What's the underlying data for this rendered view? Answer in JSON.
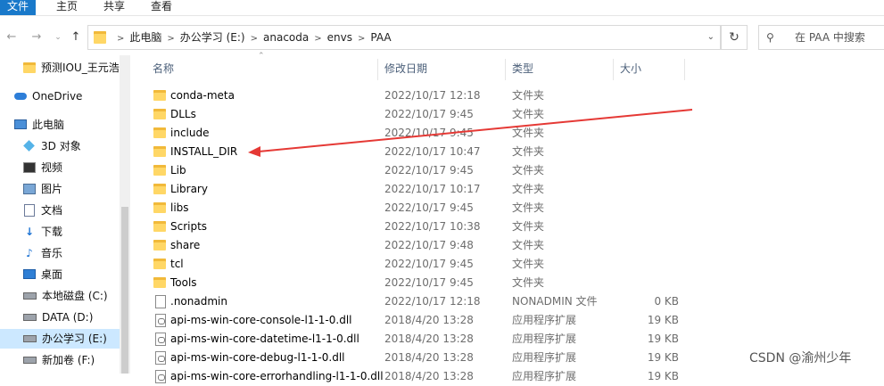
{
  "ribbon": {
    "tabs": [
      {
        "label": "文件",
        "active": true
      },
      {
        "label": "主页",
        "active": false
      },
      {
        "label": "共享",
        "active": false
      },
      {
        "label": "查看",
        "active": false
      }
    ]
  },
  "nav": {
    "back_icon": "back-arrow-icon",
    "forward_icon": "forward-arrow-icon",
    "recent_icon": "chevron-down-icon",
    "up_icon": "up-arrow-icon"
  },
  "address": {
    "crumbs": [
      "此电脑",
      "办公学习 (E:)",
      "anacoda",
      "envs",
      "PAA"
    ]
  },
  "search": {
    "placeholder": "在 PAA 中搜索"
  },
  "sidebar": {
    "items": [
      {
        "label": "预测IOU_王元浩",
        "icon": "folder-icon",
        "selected": false
      },
      {
        "label": "OneDrive",
        "icon": "cloud-icon",
        "selected": false
      },
      {
        "label": "此电脑",
        "icon": "computer-icon",
        "selected": false
      },
      {
        "label": "3D 对象",
        "icon": "3d-objects-icon",
        "selected": false
      },
      {
        "label": "视频",
        "icon": "video-icon",
        "selected": false
      },
      {
        "label": "图片",
        "icon": "pictures-icon",
        "selected": false
      },
      {
        "label": "文档",
        "icon": "documents-icon",
        "selected": false
      },
      {
        "label": "下载",
        "icon": "download-icon",
        "selected": false
      },
      {
        "label": "音乐",
        "icon": "music-icon",
        "selected": false
      },
      {
        "label": "桌面",
        "icon": "desktop-icon",
        "selected": false
      },
      {
        "label": "本地磁盘 (C:)",
        "icon": "drive-icon",
        "selected": false
      },
      {
        "label": "DATA (D:)",
        "icon": "drive-icon",
        "selected": false
      },
      {
        "label": "办公学习 (E:)",
        "icon": "drive-icon",
        "selected": true
      },
      {
        "label": "新加卷 (F:)",
        "icon": "drive-icon",
        "selected": false
      }
    ]
  },
  "columns": {
    "name": "名称",
    "date": "修改日期",
    "type": "类型",
    "size": "大小"
  },
  "files": [
    {
      "name": "conda-meta",
      "date": "2022/10/17 12:18",
      "type": "文件夹",
      "size": "",
      "kind": "folder"
    },
    {
      "name": "DLLs",
      "date": "2022/10/17 9:45",
      "type": "文件夹",
      "size": "",
      "kind": "folder"
    },
    {
      "name": "include",
      "date": "2022/10/17 9:45",
      "type": "文件夹",
      "size": "",
      "kind": "folder"
    },
    {
      "name": "INSTALL_DIR",
      "date": "2022/10/17 10:47",
      "type": "文件夹",
      "size": "",
      "kind": "folder"
    },
    {
      "name": "Lib",
      "date": "2022/10/17 9:45",
      "type": "文件夹",
      "size": "",
      "kind": "folder"
    },
    {
      "name": "Library",
      "date": "2022/10/17 10:17",
      "type": "文件夹",
      "size": "",
      "kind": "folder"
    },
    {
      "name": "libs",
      "date": "2022/10/17 9:45",
      "type": "文件夹",
      "size": "",
      "kind": "folder"
    },
    {
      "name": "Scripts",
      "date": "2022/10/17 10:38",
      "type": "文件夹",
      "size": "",
      "kind": "folder"
    },
    {
      "name": "share",
      "date": "2022/10/17 9:48",
      "type": "文件夹",
      "size": "",
      "kind": "folder"
    },
    {
      "name": "tcl",
      "date": "2022/10/17 9:45",
      "type": "文件夹",
      "size": "",
      "kind": "folder"
    },
    {
      "name": "Tools",
      "date": "2022/10/17 9:45",
      "type": "文件夹",
      "size": "",
      "kind": "folder"
    },
    {
      "name": ".nonadmin",
      "date": "2022/10/17 12:18",
      "type": "NONADMIN 文件",
      "size": "0 KB",
      "kind": "file"
    },
    {
      "name": "api-ms-win-core-console-l1-1-0.dll",
      "date": "2018/4/20 13:28",
      "type": "应用程序扩展",
      "size": "19 KB",
      "kind": "dll"
    },
    {
      "name": "api-ms-win-core-datetime-l1-1-0.dll",
      "date": "2018/4/20 13:28",
      "type": "应用程序扩展",
      "size": "19 KB",
      "kind": "dll"
    },
    {
      "name": "api-ms-win-core-debug-l1-1-0.dll",
      "date": "2018/4/20 13:28",
      "type": "应用程序扩展",
      "size": "19 KB",
      "kind": "dll"
    },
    {
      "name": "api-ms-win-core-errorhandling-l1-1-0.dll",
      "date": "2018/4/20 13:28",
      "type": "应用程序扩展",
      "size": "19 KB",
      "kind": "dll"
    }
  ],
  "annotation": {
    "color": "#e53935"
  },
  "watermark": "CSDN @渝州少年",
  "colors": {
    "accent": "#1979ca",
    "selection": "#cce8ff",
    "header_text": "#4c607a",
    "folder": "#ffd766"
  }
}
